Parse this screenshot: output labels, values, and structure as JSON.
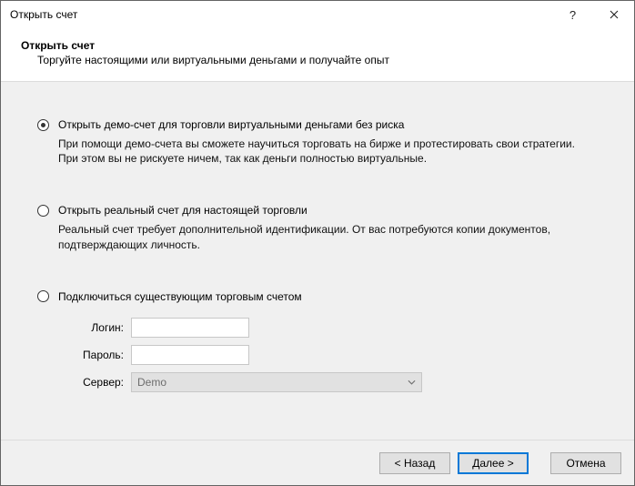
{
  "window": {
    "title": "Открыть счет"
  },
  "header": {
    "title": "Открыть счет",
    "subtitle": "Торгуйте настоящими или виртуальными деньгами и получайте опыт"
  },
  "options": {
    "demo": {
      "label": "Открыть демо-счет для торговли виртуальными деньгами без риска",
      "desc": "При помощи демо-счета вы сможете научиться торговать на бирже и протестировать свои стратегии. При этом вы не рискуете ничем, так как деньги полностью виртуальные.",
      "selected": true
    },
    "real": {
      "label": "Открыть реальный счет для настоящей торговли",
      "desc": "Реальный счет требует дополнительной идентификации. От вас потребуются копии документов, подтверждающих личность.",
      "selected": false
    },
    "existing": {
      "label": "Подключиться существующим торговым счетом",
      "selected": false,
      "form": {
        "login_label": "Логин:",
        "login_value": "",
        "password_label": "Пароль:",
        "password_value": "",
        "server_label": "Сервер:",
        "server_value": "Demo"
      }
    }
  },
  "buttons": {
    "back": "< Назад",
    "next": "Далее >",
    "cancel": "Отмена"
  }
}
